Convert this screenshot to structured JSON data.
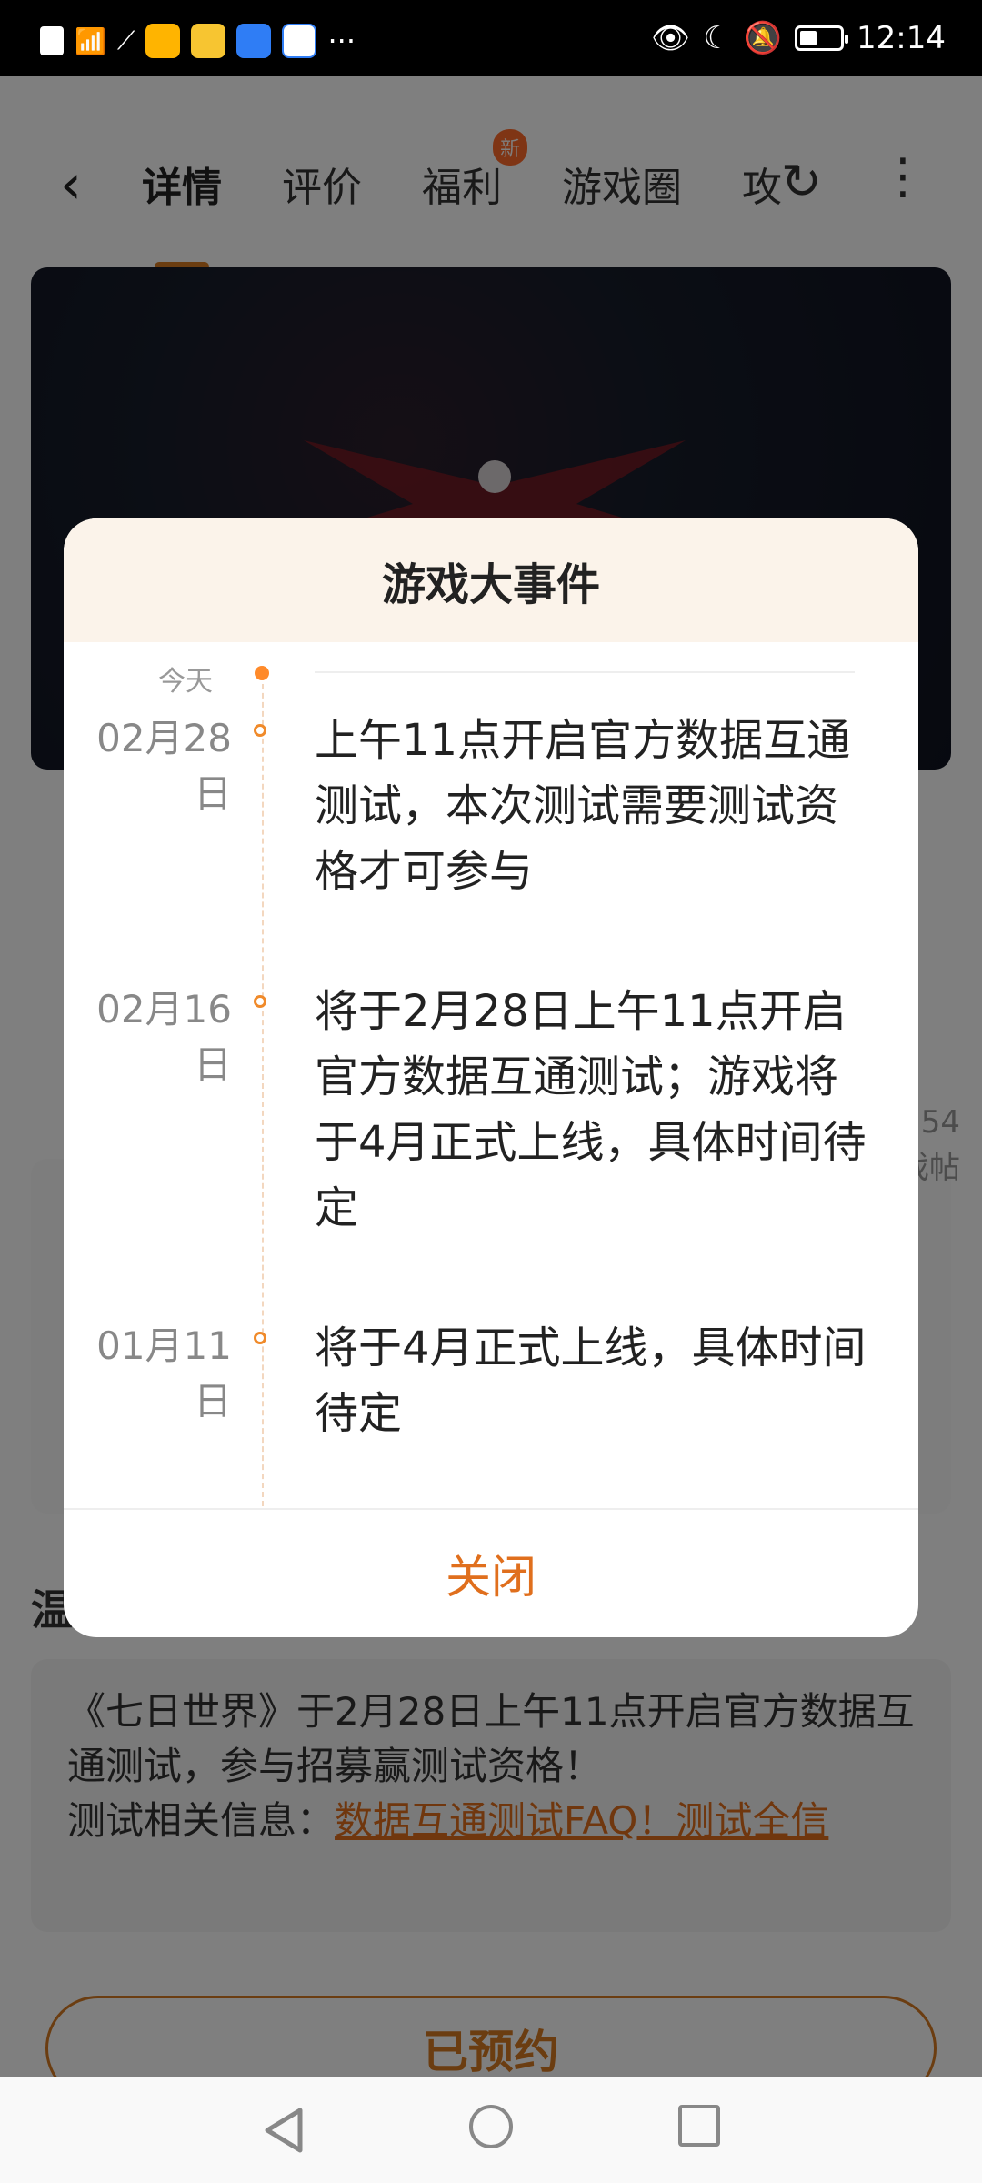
{
  "status": {
    "time": "12:14",
    "left_text": "···"
  },
  "nav": {
    "tabs": [
      {
        "label": "详情",
        "active": true
      },
      {
        "label": "评价"
      },
      {
        "label": "福利",
        "badge": "新"
      },
      {
        "label": "游戏圈"
      },
      {
        "label": "攻"
      }
    ]
  },
  "background": {
    "section_title": "温",
    "notice_text": "《七日世界》于2月28日上午11点开启官方数据互通测试，参与招募赢测试资格！",
    "notice_prefix": "测试相关信息：",
    "notice_link": "数据互通测试FAQ！测试全信",
    "reserve_label": "已预约",
    "side_count": "54",
    "side_label": "戏帖"
  },
  "dialog": {
    "title": "游戏大事件",
    "today_label": "今天",
    "events": [
      {
        "date": "02月28日",
        "text": "上午11点开启官方数据互通测试，本次测试需要测试资格才可参与"
      },
      {
        "date": "02月16日",
        "text": "将于2月28日上午11点开启官方数据互通测试；游戏将于4月正式上线，具体时间待定"
      },
      {
        "date": "01月11日",
        "text": "将于4月正式上线，具体时间待定"
      }
    ],
    "close_label": "关闭"
  },
  "colors": {
    "accent": "#e06f1d",
    "header_bg": "#fbf3ea"
  }
}
